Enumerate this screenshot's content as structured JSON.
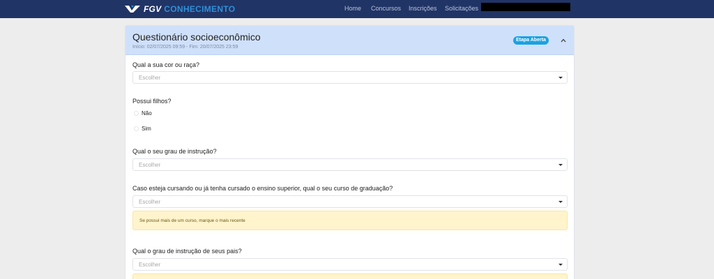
{
  "navbar": {
    "logo_fgv": "FGV",
    "logo_product": "CONHECIMENTO",
    "links": [
      "Home",
      "Concursos",
      "Inscrições",
      "Solicitações"
    ]
  },
  "card": {
    "title": "Questionário socioeconômico",
    "dates": "Início: 02/07/2025 09:59 - Fim: 20/07/2025 23:59",
    "badge": "Etapa Aberta"
  },
  "questions": {
    "q1": {
      "label": "Qual a sua cor ou raça?",
      "placeholder": "Escolher"
    },
    "q2": {
      "label": "Possui filhos?",
      "options": [
        "Não",
        "Sim"
      ]
    },
    "q3": {
      "label": "Qual o seu grau de instrução?",
      "placeholder": "Escolher"
    },
    "q4": {
      "label": "Caso esteja cursando ou já tenha cursado o ensino superior, qual o seu curso de graduação?",
      "placeholder": "Escolher",
      "hint": "Se possui mais de um curso, marque o mais recente"
    },
    "q5": {
      "label": "Qual o grau de instrução de seus pais?",
      "placeholder": "Escolher"
    }
  },
  "colors": {
    "navbar": "#213466",
    "header": "#cfe0fa",
    "badge": "#1ba2e0",
    "alert": "#fff4cc"
  }
}
